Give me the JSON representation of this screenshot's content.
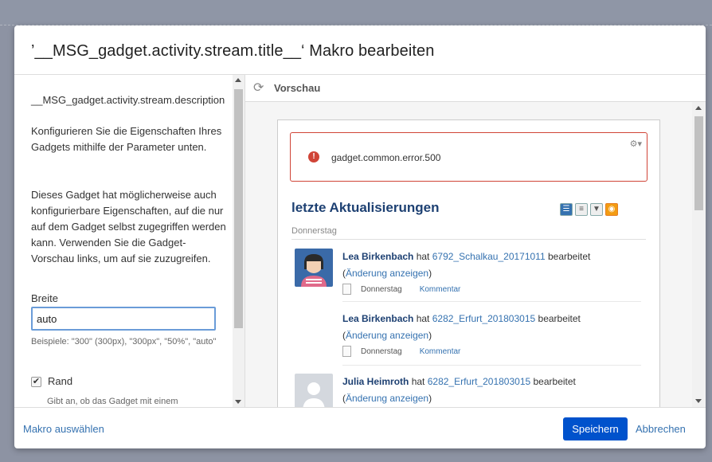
{
  "dialog": {
    "title": "’__MSG_gadget.activity.stream.title__‘ Makro bearbeiten"
  },
  "left_panel": {
    "description": "__MSG_gadget.activity.stream.description",
    "para1": "Konfigurieren Sie die Eigenschaften Ihres Gadgets mithilfe der Parameter unten.",
    "para2": "Dieses Gadget hat möglicherweise auch konfigurierbare Eigenschaften, auf die nur auf dem Gadget selbst zugegriffen werden kann. Verwenden Sie die Gadget-Vorschau links, um auf sie zuzugreifen.",
    "width_label": "Breite",
    "width_value": "auto",
    "width_hint": "Beispiele: \"300\" (300px), \"300px\", \"50%\", \"auto\"",
    "border_label": "Rand",
    "border_checked": true,
    "border_hint": "Gibt an, ob das Gadget mit einem"
  },
  "preview": {
    "label": "Vorschau",
    "error_text": "gadget.common.error.500",
    "stream_title": "letzte Aktualisierungen",
    "day_label": "Donnerstag",
    "entries": [
      {
        "user": "Lea Birkenbach",
        "verb": " hat ",
        "page": "6792_Schalkau_20171011",
        "action": " bearbeitet",
        "change_link": "Änderung anzeigen",
        "date": "Donnerstag",
        "comment": "Kommentar"
      },
      {
        "user": "Lea Birkenbach",
        "verb": " hat ",
        "page": "6282_Erfurt_201803015",
        "action": " bearbeitet",
        "change_link": "Änderung anzeigen",
        "date": "Donnerstag",
        "comment": "Kommentar"
      },
      {
        "user": "Julia Heimroth",
        "verb": " hat ",
        "page": "6282_Erfurt_201803015",
        "action": " bearbeitet",
        "change_link": "Änderung anzeigen"
      }
    ]
  },
  "footer": {
    "macro_link": "Makro auswählen",
    "save": "Speichern",
    "cancel": "Abbrechen"
  },
  "colors": {
    "primary": "#0052cc",
    "link": "#3572b0",
    "error": "#d04437",
    "stream_title": "#1d4072"
  }
}
